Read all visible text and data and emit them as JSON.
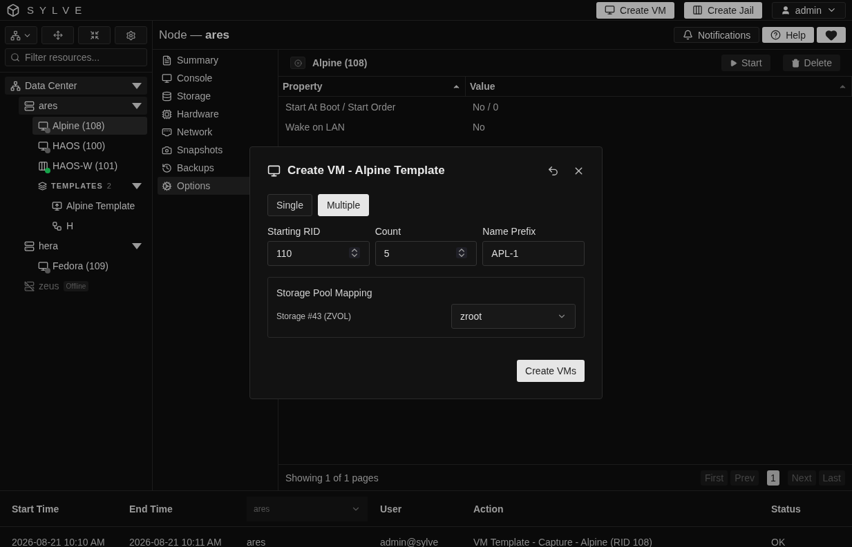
{
  "brand": "SYLVE",
  "header_buttons": [
    {
      "label": "Create VM",
      "kind": "vm"
    },
    {
      "label": "Create Jail",
      "kind": "jail"
    }
  ],
  "user": "admin",
  "page_title": "Node — **ares**",
  "top_actions": [
    {
      "label": "Notifications",
      "kind": "bell"
    },
    {
      "label": "Help",
      "kind": "help"
    },
    {
      "kind": "heart"
    }
  ],
  "filter": {
    "placeholder": "Filter resources..."
  },
  "tree": [
    {
      "label": "Data Center",
      "kind": "datacenter",
      "expanded": true,
      "selected": true,
      "children": [
        {
          "label": "ares",
          "kind": "node",
          "expanded": true,
          "selected": true,
          "children": [
            {
              "label": "Alpine (108)",
              "kind": "vm",
              "selected": true,
              "color": "#555555"
            },
            {
              "label": "HAOS (100)",
              "kind": "vm",
              "selected": false,
              "color": "#555555"
            },
            {
              "label": "HAOS-W (101)",
              "kind": "jail",
              "selected": false,
              "color": "#16a34a"
            },
            {
              "label": "TEMPLATES",
              "count": "2",
              "kind": "group",
              "expanded": true,
              "selected": false,
              "children": [
                {
                  "label": "Alpine Template",
                  "kind": "template",
                  "selected": false
                },
                {
                  "label": "H",
                  "kind": "template_jail",
                  "selected": false
                }
              ]
            }
          ]
        },
        {
          "label": "hera",
          "kind": "node",
          "expanded": true,
          "selected": false,
          "children": [
            {
              "label": "Fedora (109)",
              "kind": "vm",
              "selected": false,
              "color": "#555555"
            }
          ]
        },
        {
          "label": "zeus",
          "kind": "offline_node",
          "badge": "Offline",
          "selected": false
        }
      ]
    }
  ],
  "menu": [
    {
      "label": "Summary",
      "kind": "summary",
      "selected": false
    },
    {
      "label": "Console",
      "kind": "console",
      "selected": false
    },
    {
      "label": "Storage",
      "kind": "storage",
      "selected": false
    },
    {
      "label": "Hardware",
      "kind": "hardware",
      "selected": false
    },
    {
      "label": "Network",
      "kind": "network",
      "selected": false
    },
    {
      "label": "Snapshots",
      "kind": "snapshots",
      "selected": false
    },
    {
      "label": "Backups",
      "kind": "backups",
      "selected": false
    },
    {
      "label": "Options",
      "kind": "options",
      "selected": true
    }
  ],
  "panel": {
    "title": "Alpine (108)",
    "actions": [
      {
        "label": "Start",
        "kind": "play"
      },
      {
        "label": "Delete",
        "kind": "trash"
      }
    ]
  },
  "table": {
    "columns": [
      "Property",
      "Value"
    ],
    "rows": [
      [
        "Start At Boot / Start Order",
        "No / 0"
      ],
      [
        "Wake on LAN",
        "No"
      ]
    ]
  },
  "pagination": {
    "summary": "Showing 1 of 1 pages",
    "buttons": [
      {
        "label": "First",
        "disabled": true,
        "selected": false
      },
      {
        "label": "Prev",
        "disabled": true,
        "selected": false
      },
      {
        "label": "1",
        "disabled": false,
        "selected": true
      },
      {
        "label": "Next",
        "disabled": true,
        "selected": false
      },
      {
        "label": "Last",
        "disabled": true,
        "selected": false
      }
    ]
  },
  "tasks": {
    "columns": [
      {
        "label": "Start Time",
        "kind": "text"
      },
      {
        "label": "End Time",
        "kind": "text"
      },
      {
        "label": "ares",
        "kind": "select"
      },
      {
        "label": "User",
        "kind": "text"
      },
      {
        "label": "Action",
        "kind": "text"
      },
      {
        "label": "Status",
        "kind": "text"
      }
    ],
    "rows": [
      [
        "2026-08-21 10:10 AM",
        "2026-08-21 10:11 AM",
        "ares",
        "admin@sylve",
        "VM Template - Capture - Alpine (RID 108)",
        "OK"
      ]
    ]
  },
  "dialog": {
    "title": "Create VM - Alpine Template",
    "modes": [
      {
        "label": "Single",
        "selected": false
      },
      {
        "label": "Multiple",
        "selected": true
      }
    ],
    "fields": [
      {
        "label": "Starting RID",
        "value": "110",
        "kind": "number"
      },
      {
        "label": "Count",
        "value": "5",
        "kind": "number"
      },
      {
        "label": "Name Prefix",
        "value": "APL-1",
        "kind": "text"
      }
    ],
    "mapping": {
      "title": "Storage Pool Mapping",
      "rows": [
        {
          "label": "Storage #43 (ZVOL)",
          "value": "zroot"
        }
      ]
    },
    "submit": "Create VMs"
  }
}
